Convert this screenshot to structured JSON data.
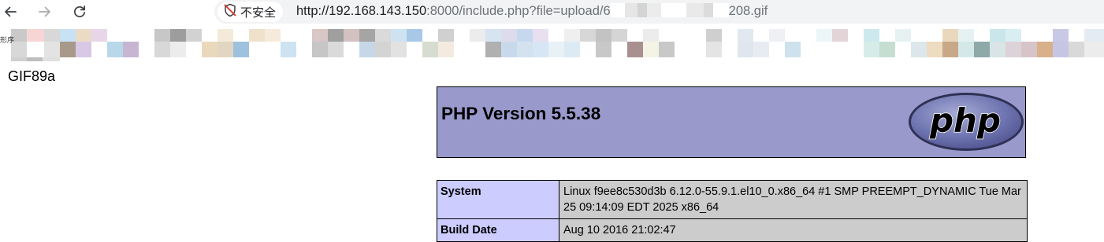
{
  "browser": {
    "security_label": "不安全",
    "url_host": "http://192.168.143.150",
    "url_path": ":8000/include.php?file=upload/",
    "url_prefix_digit": "6",
    "url_suffix": "208.gif",
    "icons": {
      "back": "arrow-left-icon",
      "forward": "arrow-right-icon",
      "reload": "reload-icon",
      "security": "shield-slash-icon"
    },
    "colors": {
      "omnibox": "#f1f3f4",
      "security_chip": "#ffffff"
    }
  },
  "bookmarks_bar": {
    "fragment": "形序"
  },
  "page": {
    "file_header": "GIF89a",
    "phpinfo": {
      "title": "PHP Version 5.5.38",
      "logo_text": "php",
      "rows": [
        {
          "key": "System",
          "value": "Linux f9ee8c530d3b 6.12.0-55.9.1.el10_0.x86_64 #1 SMP PREEMPT_DYNAMIC Tue Mar 25 09:14:09 EDT 2025 x86_64"
        },
        {
          "key": "Build Date",
          "value": "Aug 10 2016 21:02:47"
        }
      ],
      "colors": {
        "banner": "#9999cc",
        "key_cell": "#ccccff",
        "value_cell": "#cccccc"
      }
    }
  }
}
